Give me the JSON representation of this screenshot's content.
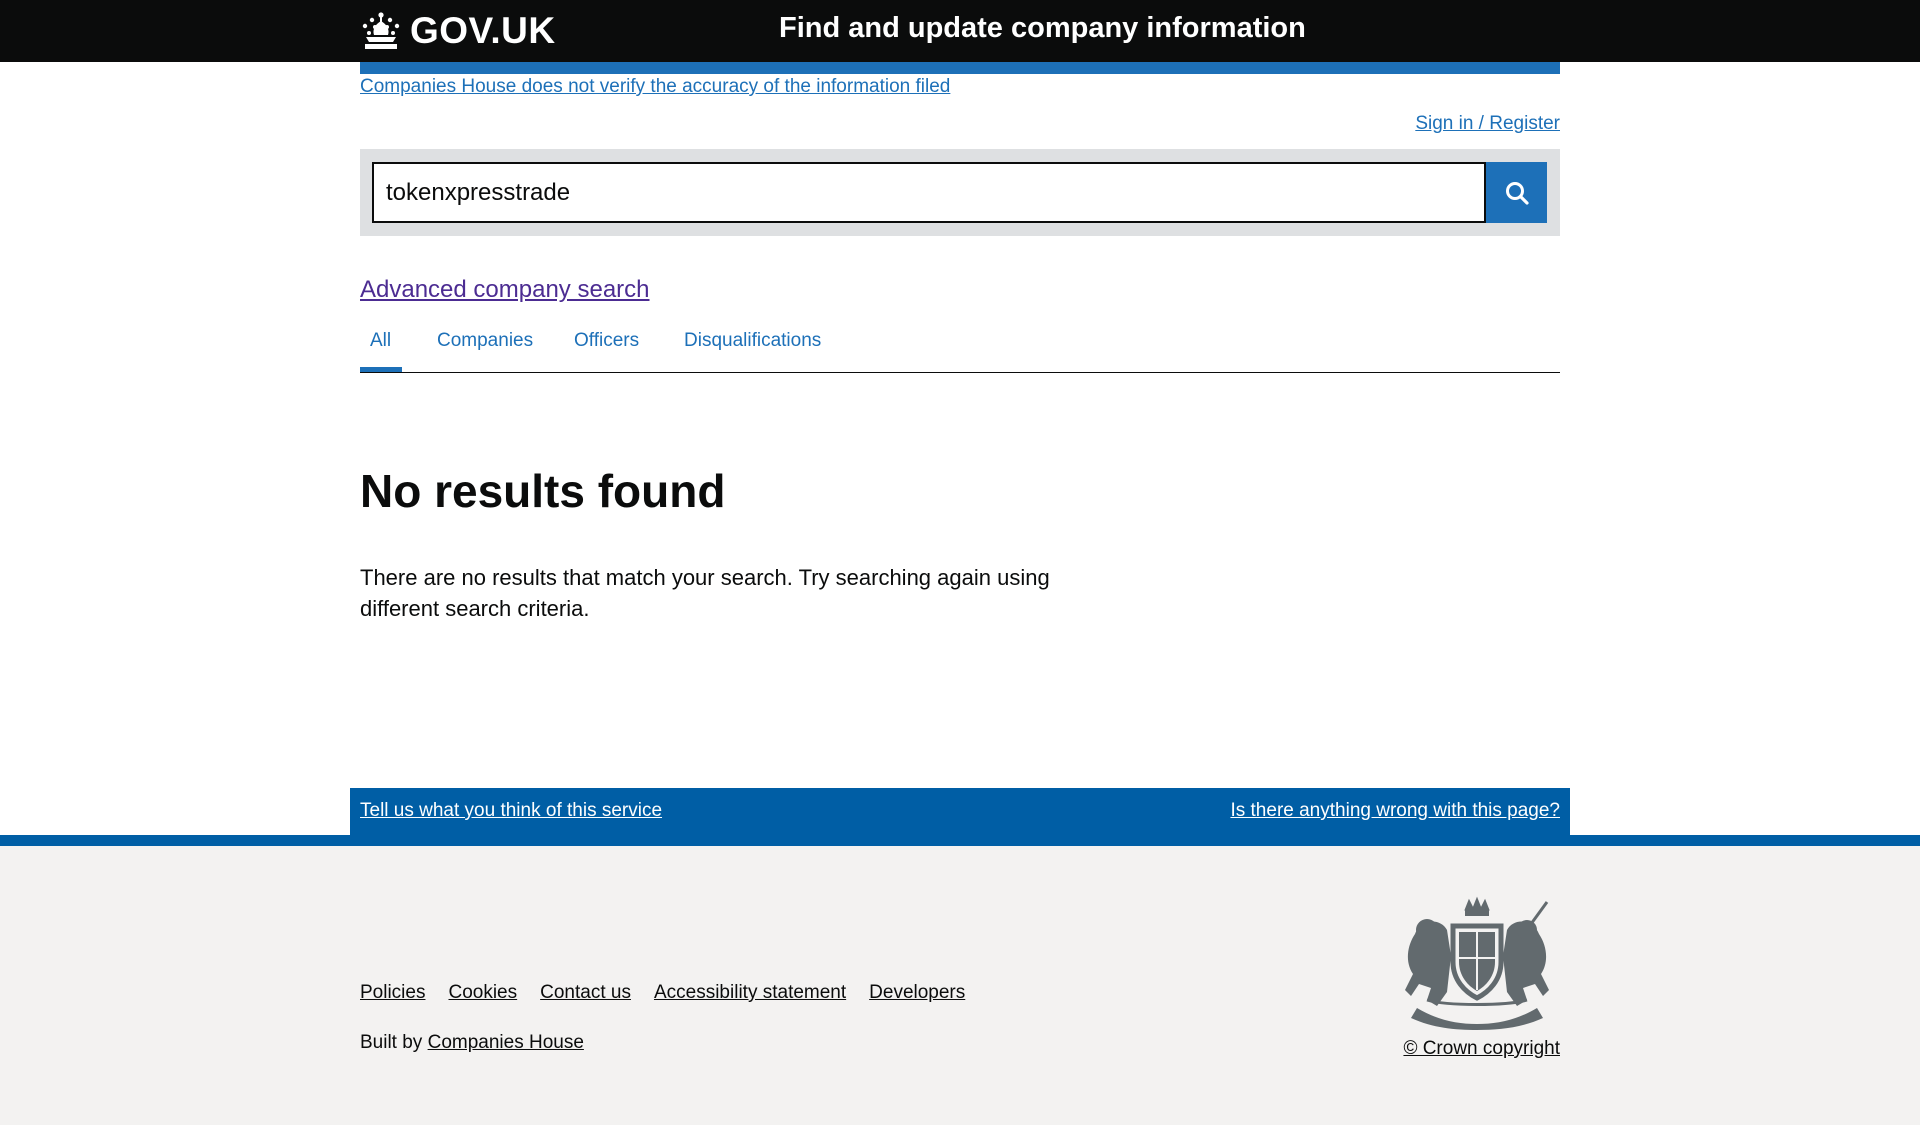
{
  "header": {
    "logo_text": "GOV.UK",
    "service_name": "Find and update company information"
  },
  "notice": {
    "disclaimer": "Companies House does not verify the accuracy of the information filed",
    "sign_in": "Sign in / Register"
  },
  "search": {
    "value": "tokenxpresstrade",
    "button_icon": "search-icon"
  },
  "advanced_link": "Advanced company search",
  "tabs": [
    {
      "label": "All",
      "selected": true
    },
    {
      "label": "Companies",
      "selected": false
    },
    {
      "label": "Officers",
      "selected": false
    },
    {
      "label": "Disqualifications",
      "selected": false
    }
  ],
  "results": {
    "heading": "No results found",
    "message": "There are no results that match your search. Try searching again using different search criteria."
  },
  "feedback": {
    "left": "Tell us what you think of this service",
    "right": "Is there anything wrong with this page?"
  },
  "footer": {
    "links": [
      "Policies",
      "Cookies",
      "Contact us",
      "Accessibility statement",
      "Developers"
    ],
    "built_by_prefix": "Built by",
    "built_by_link": "Companies House",
    "copyright": "© Crown copyright"
  },
  "colors": {
    "header_bg": "#0b0c0c",
    "brand_blue": "#1d70b8",
    "feedback_blue": "#005ea5",
    "visited_link": "#4c2c92",
    "search_panel": "#dee0e2",
    "footer_bg": "#f3f2f1"
  }
}
